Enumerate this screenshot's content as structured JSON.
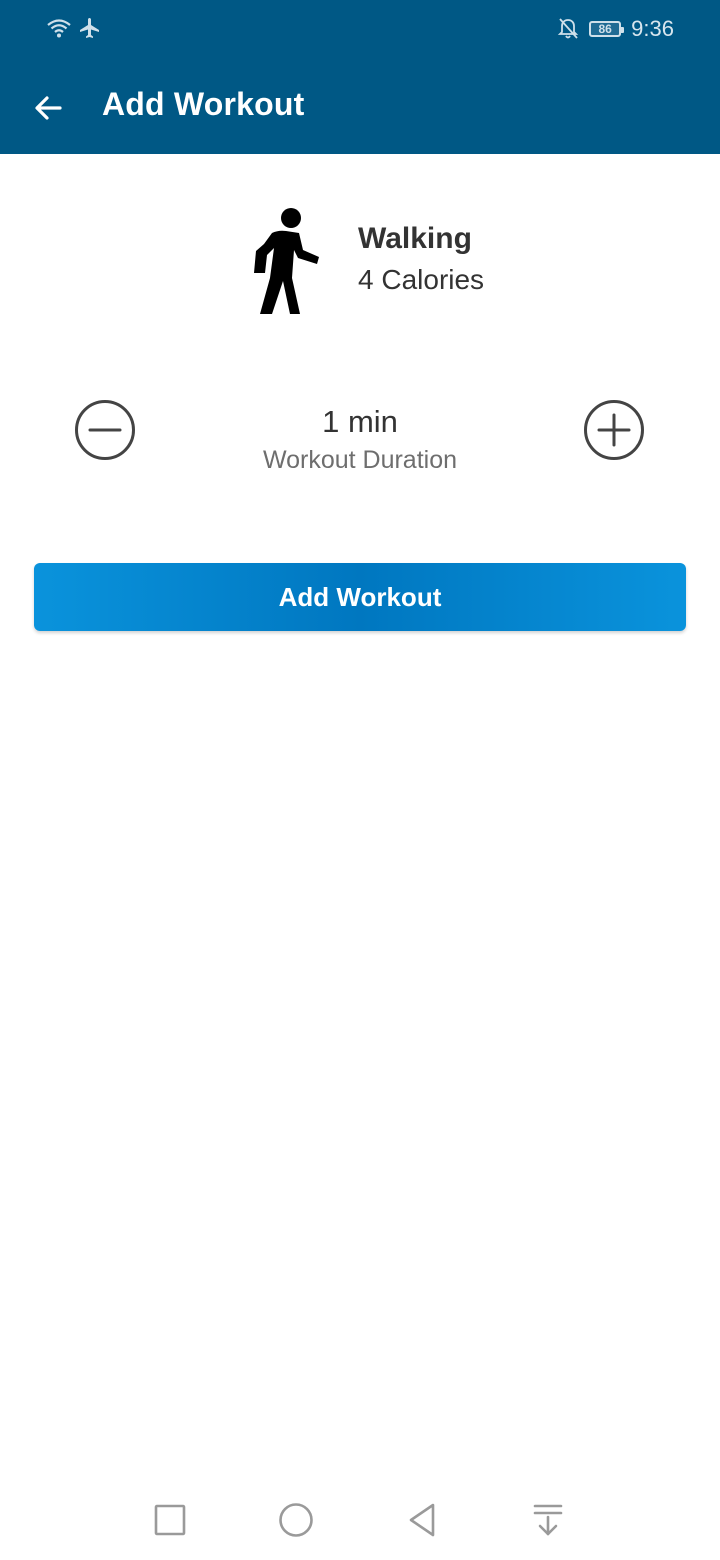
{
  "status_bar": {
    "battery_level": "86",
    "time": "9:36",
    "icons": [
      "wifi-icon",
      "airplane-mode-icon",
      "notifications-off-icon",
      "battery-icon"
    ]
  },
  "app_bar": {
    "title": "Add Workout",
    "back_icon": "arrow-back-icon"
  },
  "workout": {
    "name": "Walking",
    "calories": "4 Calories",
    "icon": "walking-person-icon"
  },
  "duration": {
    "value": "1 min",
    "label": "Workout Duration",
    "decrease_icon": "minus-circle-icon",
    "increase_icon": "plus-circle-icon"
  },
  "actions": {
    "add_label": "Add Workout"
  },
  "nav_bar": {
    "icons": [
      "recent-apps-icon",
      "home-icon",
      "back-icon",
      "notification-pull-icon"
    ]
  },
  "colors": {
    "header": "#005885",
    "button": "#0a93dc",
    "text_primary": "#333333",
    "text_secondary": "#6e6e6e"
  }
}
